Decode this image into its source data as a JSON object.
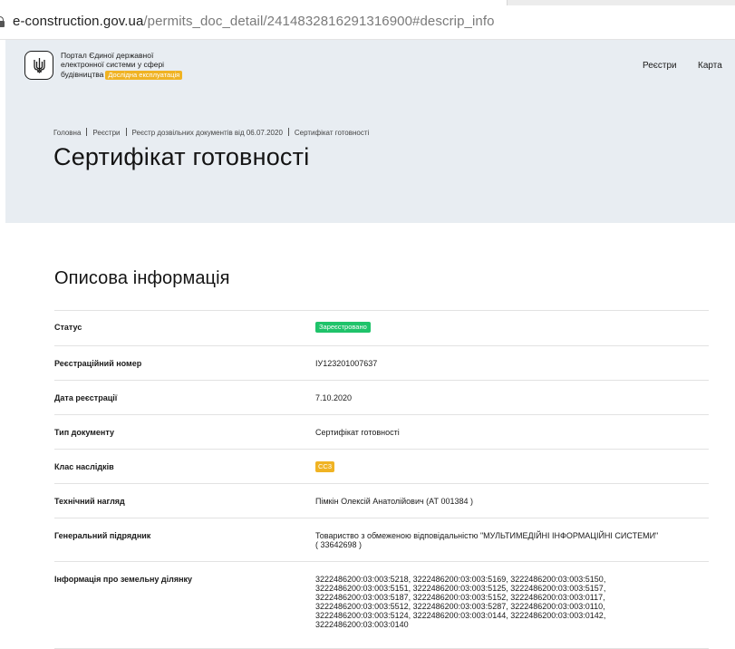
{
  "browser": {
    "url_host": "e-construction.gov.ua",
    "url_path": "/permits_doc_detail/2414832816291316900#descrip_info"
  },
  "header": {
    "portal_line1": "Портал Єдиної державної",
    "portal_line2": "електронної системи у сфері",
    "portal_line3": "будівництва",
    "beta_badge": "Дослідна експлуатація",
    "nav_registries": "Реєстри",
    "nav_map": "Карта"
  },
  "breadcrumbs": [
    "Головна",
    "Реєстри",
    "Реєстр дозвільних документів від 06.07.2020",
    "Сертифікат готовності"
  ],
  "page_title": "Сертифікат готовності",
  "section_title": "Описова інформація",
  "rows": {
    "status": {
      "label": "Статус",
      "value": "Зареєстровано",
      "color": "#1fc36a"
    },
    "reg_number": {
      "label": "Реєстраційний номер",
      "value": "ІУ123201007637"
    },
    "reg_date": {
      "label": "Дата реєстрації",
      "value": "7.10.2020"
    },
    "doc_type": {
      "label": "Тип документу",
      "value": "Сертифікат готовності"
    },
    "class": {
      "label": "Клас наслідків",
      "value": "СС3",
      "color": "#f0b323"
    },
    "supervision": {
      "label": "Технічний нагляд",
      "value": "Пімкін Олексій Анатолійович (АТ 001384 )"
    },
    "contractor": {
      "label": "Генеральний підрядник",
      "line1": "Товариство з обмеженою відповідальністю \"МУЛЬТИМЕДІЙНІ ІНФОРМАЦІЙНІ СИСТЕМИ\"",
      "line2": "( 33642698 )"
    },
    "land": {
      "label": "Інформація про земельну ділянку",
      "lines": [
        "3222486200:03:003:5218, 3222486200:03:003:5169, 3222486200:03:003:5150,",
        "3222486200:03:003:5151, 3222486200:03:003:5125, 3222486200:03:003:5157,",
        "3222486200:03:003:5187, 3222486200:03:003:5152, 3222486200:03:003:0117,",
        "3222486200:03:003:5512, 3222486200:03:003:5287, 3222486200:03:003:0110,",
        "3222486200:03:003:5124, 3222486200:03:003:0144, 3222486200:03:003:0142,",
        "3222486200:03:003:0140"
      ]
    }
  }
}
